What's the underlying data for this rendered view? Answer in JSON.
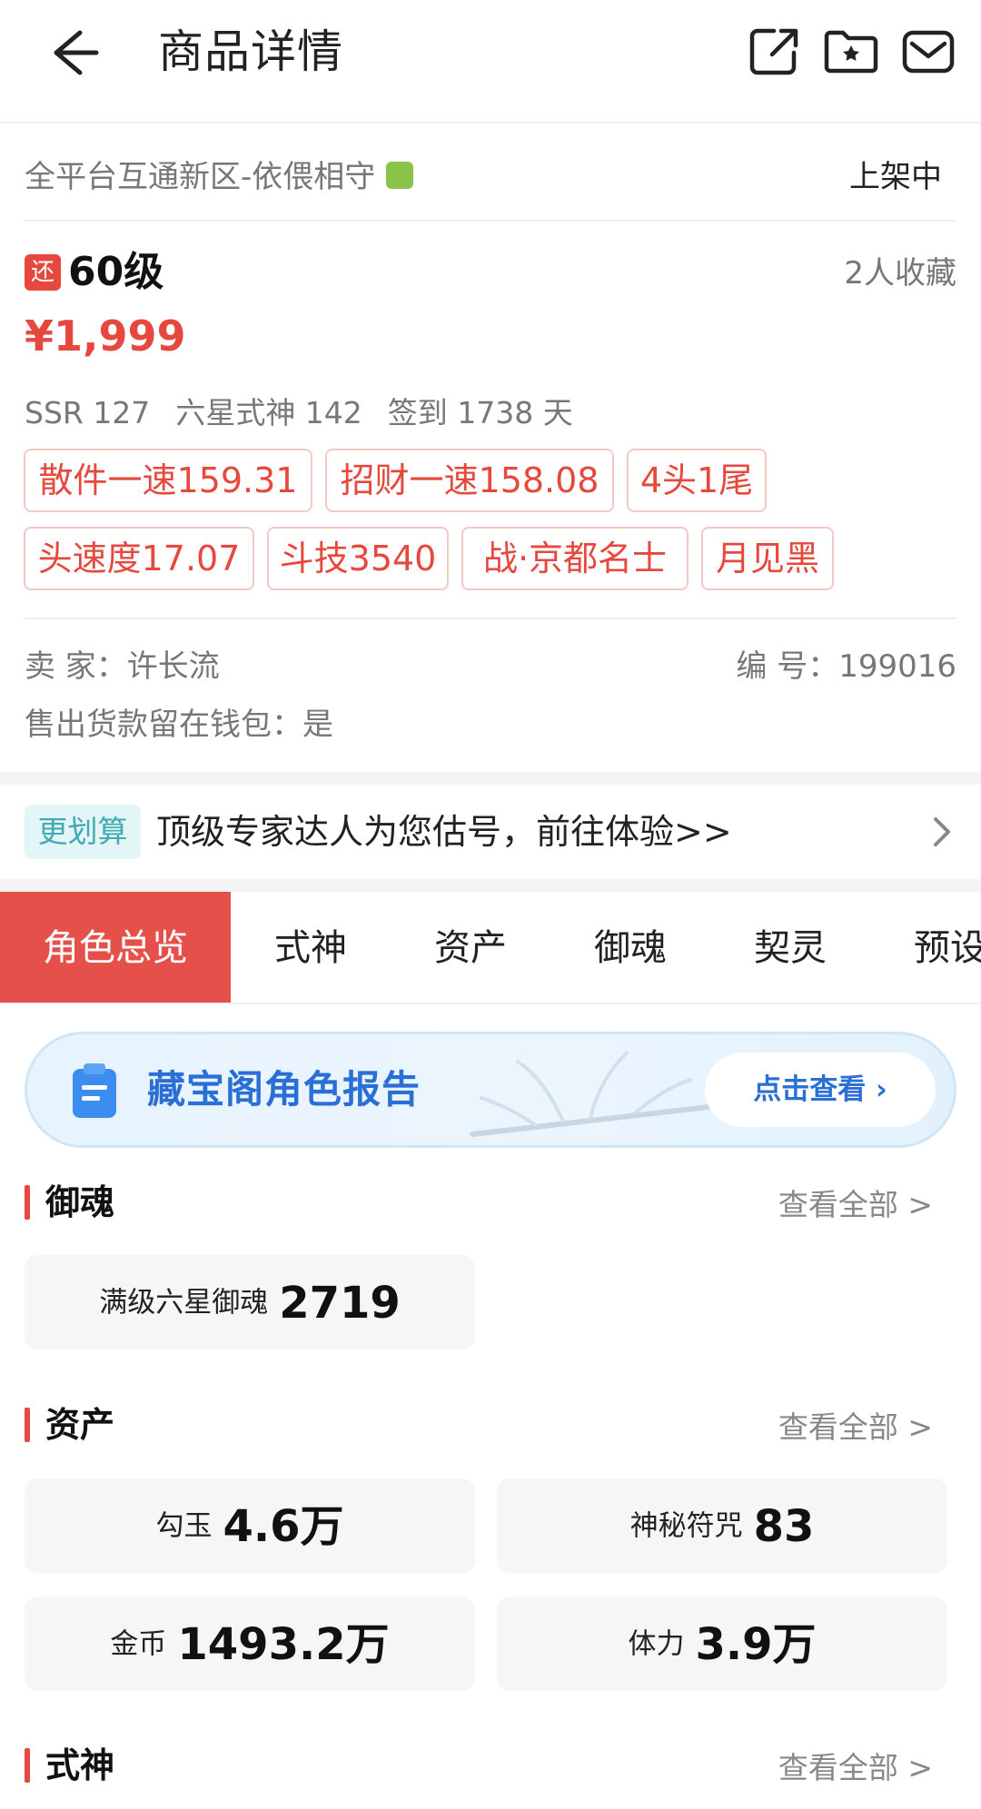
{
  "header": {
    "title": "商品详情",
    "icons": [
      "back-arrow-icon",
      "share-icon",
      "folder-star-icon",
      "mail-icon"
    ]
  },
  "info": {
    "server": "全平台互通新区-依偎相守",
    "status": "上架中",
    "return_tag": "还",
    "level": "60级",
    "favorites": "2人收藏",
    "price": "¥1,999",
    "stats": [
      "SSR 127",
      "六星式神 142",
      "签到 1738 天"
    ],
    "tags": [
      "散件一速159.31",
      "招财一速158.08",
      "4头1尾",
      "头速度17.07",
      "斗技3540",
      "战·京都名士",
      "月见黑"
    ],
    "seller": "卖  家：许长流",
    "serial": "编  号：199016",
    "wallet": "售出货款留在钱包：是"
  },
  "promo": {
    "tag": "更划算",
    "text": "顶级专家达人为您估号，前往体验>>"
  },
  "tabs": [
    "角色总览",
    "式神",
    "资产",
    "御魂",
    "契灵",
    "预设"
  ],
  "banner": {
    "title": "藏宝阁角色报告",
    "button": "点击查看 ›"
  },
  "sections": {
    "yuhun": {
      "title": "御魂",
      "more": "查看全部 >",
      "cards": [
        {
          "label": "满级六星御魂",
          "value": "2719"
        }
      ]
    },
    "assets": {
      "title": "资产",
      "more": "查看全部 >",
      "cards": [
        {
          "label": "勾玉",
          "value": "4.6万"
        },
        {
          "label": "神秘符咒",
          "value": "83"
        },
        {
          "label": "金币",
          "value": "1493.2万"
        },
        {
          "label": "体力",
          "value": "3.9万"
        }
      ]
    },
    "shikigami": {
      "title": "式神",
      "more": "查看全部 >"
    }
  },
  "colors": {
    "accent": "#e6483d",
    "banner_blue": "#2a6fd6",
    "promo_teal": "#3fa9b4"
  }
}
